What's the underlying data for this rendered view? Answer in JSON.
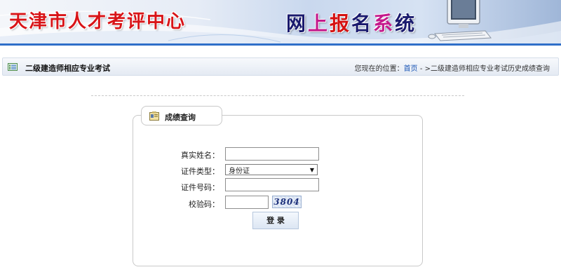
{
  "header": {
    "org_name": "天津市人才考评中心",
    "system_title_chars": [
      "网",
      "上",
      "报",
      "名",
      "系",
      "统"
    ]
  },
  "location_bar": {
    "page_title": "二级建造师相应专业考试",
    "prefix": "您现在的位置：",
    "home_link": "首页",
    "trail": " - >二级建造师相应专业考试历史成绩查询"
  },
  "panel": {
    "title": "成绩查询"
  },
  "form": {
    "name_label": "真实姓名：",
    "name_value": "",
    "id_type_label": "证件类型：",
    "id_type_selected": "身份证",
    "id_number_label": "证件号码：",
    "id_number_value": "",
    "captcha_label": "校验码：",
    "captcha_value": "",
    "captcha_image_text": "3804",
    "login_button": "登 录"
  },
  "colors": {
    "banner_rule": "#2f6fc9",
    "org_name": "#d81418",
    "link": "#1a55b5"
  },
  "icons": [
    "list-icon",
    "computer-icon",
    "form-icon",
    "dropdown-arrow-icon"
  ]
}
